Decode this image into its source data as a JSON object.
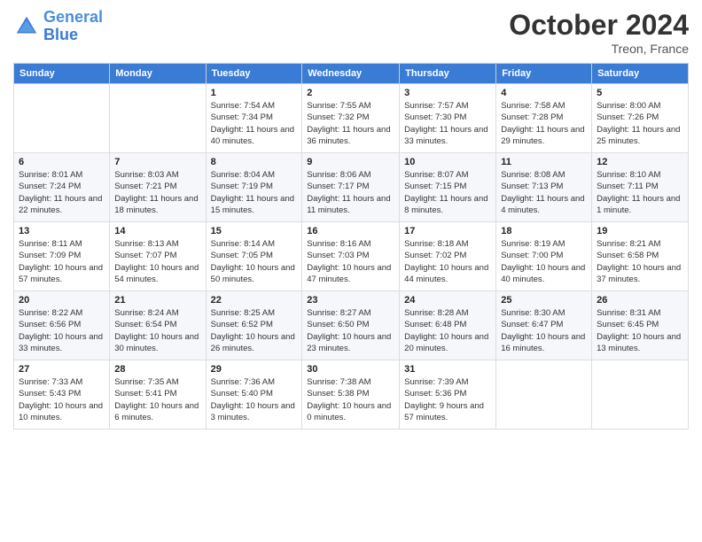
{
  "header": {
    "logo_line1": "General",
    "logo_line2": "Blue",
    "month": "October 2024",
    "location": "Treon, France"
  },
  "weekdays": [
    "Sunday",
    "Monday",
    "Tuesday",
    "Wednesday",
    "Thursday",
    "Friday",
    "Saturday"
  ],
  "weeks": [
    [
      {
        "day": "",
        "info": ""
      },
      {
        "day": "",
        "info": ""
      },
      {
        "day": "1",
        "info": "Sunrise: 7:54 AM\nSunset: 7:34 PM\nDaylight: 11 hours and 40 minutes."
      },
      {
        "day": "2",
        "info": "Sunrise: 7:55 AM\nSunset: 7:32 PM\nDaylight: 11 hours and 36 minutes."
      },
      {
        "day": "3",
        "info": "Sunrise: 7:57 AM\nSunset: 7:30 PM\nDaylight: 11 hours and 33 minutes."
      },
      {
        "day": "4",
        "info": "Sunrise: 7:58 AM\nSunset: 7:28 PM\nDaylight: 11 hours and 29 minutes."
      },
      {
        "day": "5",
        "info": "Sunrise: 8:00 AM\nSunset: 7:26 PM\nDaylight: 11 hours and 25 minutes."
      }
    ],
    [
      {
        "day": "6",
        "info": "Sunrise: 8:01 AM\nSunset: 7:24 PM\nDaylight: 11 hours and 22 minutes."
      },
      {
        "day": "7",
        "info": "Sunrise: 8:03 AM\nSunset: 7:21 PM\nDaylight: 11 hours and 18 minutes."
      },
      {
        "day": "8",
        "info": "Sunrise: 8:04 AM\nSunset: 7:19 PM\nDaylight: 11 hours and 15 minutes."
      },
      {
        "day": "9",
        "info": "Sunrise: 8:06 AM\nSunset: 7:17 PM\nDaylight: 11 hours and 11 minutes."
      },
      {
        "day": "10",
        "info": "Sunrise: 8:07 AM\nSunset: 7:15 PM\nDaylight: 11 hours and 8 minutes."
      },
      {
        "day": "11",
        "info": "Sunrise: 8:08 AM\nSunset: 7:13 PM\nDaylight: 11 hours and 4 minutes."
      },
      {
        "day": "12",
        "info": "Sunrise: 8:10 AM\nSunset: 7:11 PM\nDaylight: 11 hours and 1 minute."
      }
    ],
    [
      {
        "day": "13",
        "info": "Sunrise: 8:11 AM\nSunset: 7:09 PM\nDaylight: 10 hours and 57 minutes."
      },
      {
        "day": "14",
        "info": "Sunrise: 8:13 AM\nSunset: 7:07 PM\nDaylight: 10 hours and 54 minutes."
      },
      {
        "day": "15",
        "info": "Sunrise: 8:14 AM\nSunset: 7:05 PM\nDaylight: 10 hours and 50 minutes."
      },
      {
        "day": "16",
        "info": "Sunrise: 8:16 AM\nSunset: 7:03 PM\nDaylight: 10 hours and 47 minutes."
      },
      {
        "day": "17",
        "info": "Sunrise: 8:18 AM\nSunset: 7:02 PM\nDaylight: 10 hours and 44 minutes."
      },
      {
        "day": "18",
        "info": "Sunrise: 8:19 AM\nSunset: 7:00 PM\nDaylight: 10 hours and 40 minutes."
      },
      {
        "day": "19",
        "info": "Sunrise: 8:21 AM\nSunset: 6:58 PM\nDaylight: 10 hours and 37 minutes."
      }
    ],
    [
      {
        "day": "20",
        "info": "Sunrise: 8:22 AM\nSunset: 6:56 PM\nDaylight: 10 hours and 33 minutes."
      },
      {
        "day": "21",
        "info": "Sunrise: 8:24 AM\nSunset: 6:54 PM\nDaylight: 10 hours and 30 minutes."
      },
      {
        "day": "22",
        "info": "Sunrise: 8:25 AM\nSunset: 6:52 PM\nDaylight: 10 hours and 26 minutes."
      },
      {
        "day": "23",
        "info": "Sunrise: 8:27 AM\nSunset: 6:50 PM\nDaylight: 10 hours and 23 minutes."
      },
      {
        "day": "24",
        "info": "Sunrise: 8:28 AM\nSunset: 6:48 PM\nDaylight: 10 hours and 20 minutes."
      },
      {
        "day": "25",
        "info": "Sunrise: 8:30 AM\nSunset: 6:47 PM\nDaylight: 10 hours and 16 minutes."
      },
      {
        "day": "26",
        "info": "Sunrise: 8:31 AM\nSunset: 6:45 PM\nDaylight: 10 hours and 13 minutes."
      }
    ],
    [
      {
        "day": "27",
        "info": "Sunrise: 7:33 AM\nSunset: 5:43 PM\nDaylight: 10 hours and 10 minutes."
      },
      {
        "day": "28",
        "info": "Sunrise: 7:35 AM\nSunset: 5:41 PM\nDaylight: 10 hours and 6 minutes."
      },
      {
        "day": "29",
        "info": "Sunrise: 7:36 AM\nSunset: 5:40 PM\nDaylight: 10 hours and 3 minutes."
      },
      {
        "day": "30",
        "info": "Sunrise: 7:38 AM\nSunset: 5:38 PM\nDaylight: 10 hours and 0 minutes."
      },
      {
        "day": "31",
        "info": "Sunrise: 7:39 AM\nSunset: 5:36 PM\nDaylight: 9 hours and 57 minutes."
      },
      {
        "day": "",
        "info": ""
      },
      {
        "day": "",
        "info": ""
      }
    ]
  ]
}
